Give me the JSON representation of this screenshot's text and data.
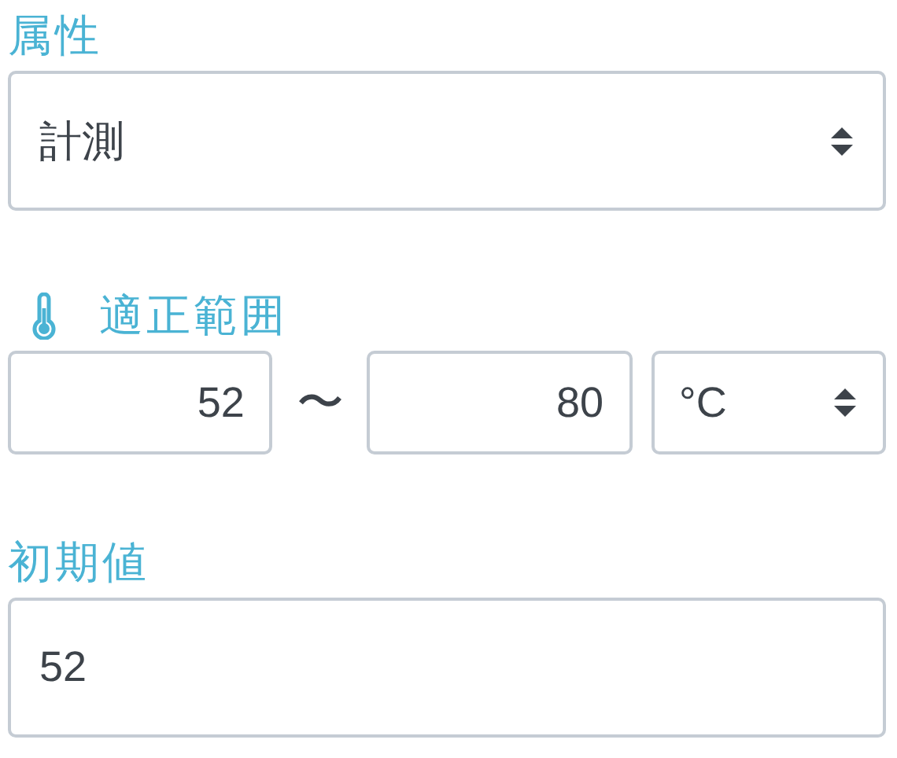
{
  "attribute": {
    "label": "属性",
    "value": "計測"
  },
  "range": {
    "label": "適正範囲",
    "min": "52",
    "separator": "〜",
    "max": "80",
    "unit": "°C"
  },
  "initial": {
    "label": "初期値",
    "value": "52"
  }
}
